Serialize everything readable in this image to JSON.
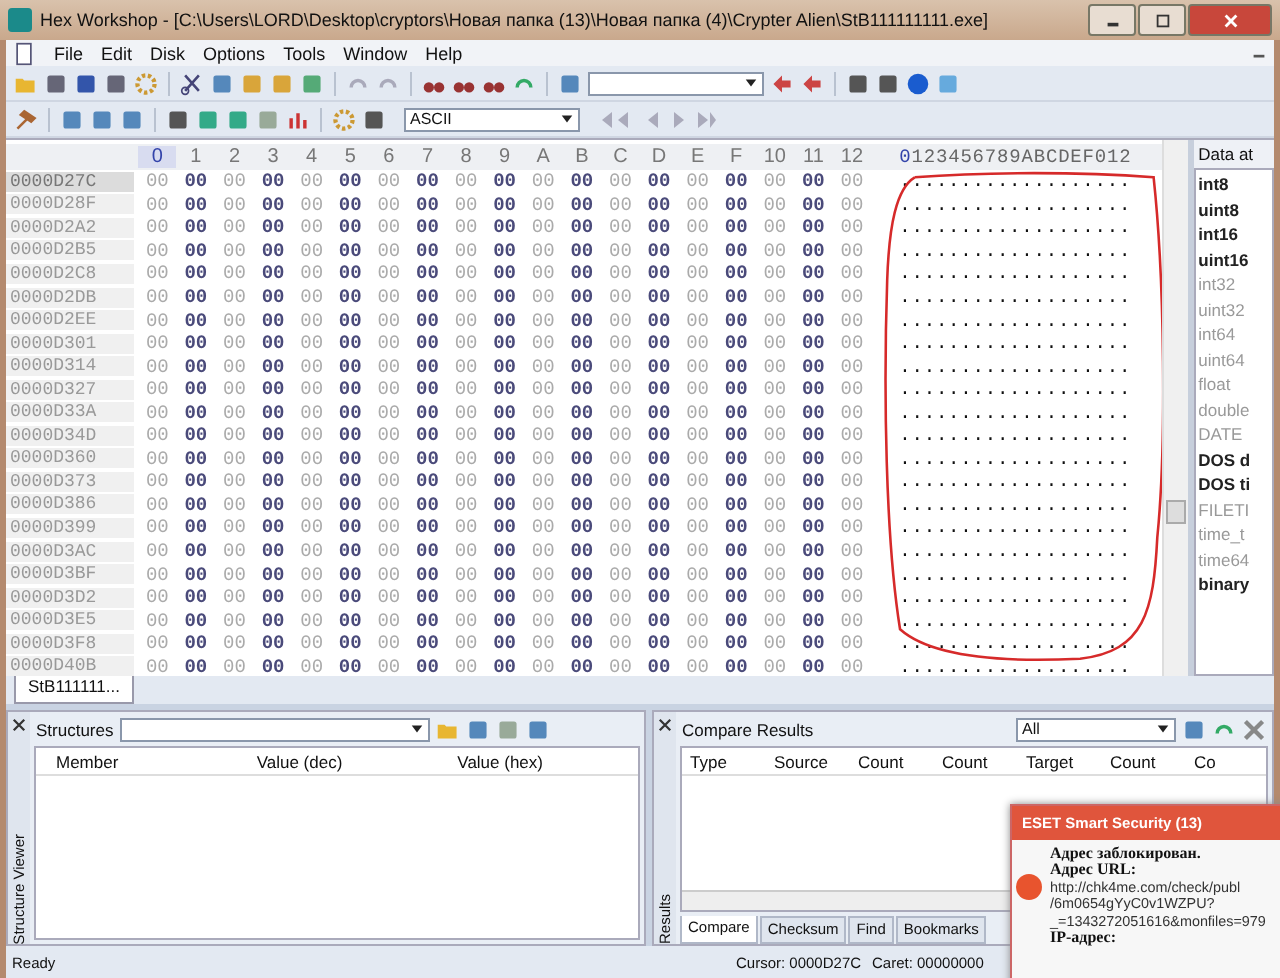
{
  "window": {
    "title": "Hex Workshop - [C:\\Users\\LORD\\Desktop\\cryptors\\Новая папка (13)\\Новая папка (4)\\Crypter Alien\\StB111111111.exe]"
  },
  "menu": [
    "File",
    "Edit",
    "Disk",
    "Options",
    "Tools",
    "Window",
    "Help"
  ],
  "toolbar": {
    "encoding": "ASCII"
  },
  "hex_view": {
    "columns": [
      {
        "label": "0",
        "selected": true
      },
      {
        "label": "1",
        "selected": false
      },
      {
        "label": "2",
        "selected": false
      },
      {
        "label": "3",
        "selected": false
      },
      {
        "label": "4",
        "selected": false
      },
      {
        "label": "5",
        "selected": false
      },
      {
        "label": "6",
        "selected": false
      },
      {
        "label": "7",
        "selected": false
      },
      {
        "label": "8",
        "selected": false
      },
      {
        "label": "9",
        "selected": false
      },
      {
        "label": "A",
        "selected": false
      },
      {
        "label": "B",
        "selected": false
      },
      {
        "label": "C",
        "selected": false
      },
      {
        "label": "D",
        "selected": false
      },
      {
        "label": "E",
        "selected": false
      },
      {
        "label": "F",
        "selected": false
      },
      {
        "label": "10",
        "selected": false
      },
      {
        "label": "11",
        "selected": false
      },
      {
        "label": "12",
        "selected": false
      }
    ],
    "ascii_header": "0123456789ABCDEF012",
    "rows": [
      {
        "offset": "0000D27C",
        "selected": true,
        "bytes": [
          "00",
          "00",
          "00",
          "00",
          "00",
          "00",
          "00",
          "00",
          "00",
          "00",
          "00",
          "00",
          "00",
          "00",
          "00",
          "00",
          "00",
          "00",
          "00"
        ],
        "ascii": "..................."
      },
      {
        "offset": "0000D28F",
        "selected": false,
        "bytes": [
          "00",
          "00",
          "00",
          "00",
          "00",
          "00",
          "00",
          "00",
          "00",
          "00",
          "00",
          "00",
          "00",
          "00",
          "00",
          "00",
          "00",
          "00",
          "00"
        ],
        "ascii": "..................."
      },
      {
        "offset": "0000D2A2",
        "selected": false,
        "bytes": [
          "00",
          "00",
          "00",
          "00",
          "00",
          "00",
          "00",
          "00",
          "00",
          "00",
          "00",
          "00",
          "00",
          "00",
          "00",
          "00",
          "00",
          "00",
          "00"
        ],
        "ascii": "..................."
      },
      {
        "offset": "0000D2B5",
        "selected": false,
        "bytes": [
          "00",
          "00",
          "00",
          "00",
          "00",
          "00",
          "00",
          "00",
          "00",
          "00",
          "00",
          "00",
          "00",
          "00",
          "00",
          "00",
          "00",
          "00",
          "00"
        ],
        "ascii": "..................."
      },
      {
        "offset": "0000D2C8",
        "selected": false,
        "bytes": [
          "00",
          "00",
          "00",
          "00",
          "00",
          "00",
          "00",
          "00",
          "00",
          "00",
          "00",
          "00",
          "00",
          "00",
          "00",
          "00",
          "00",
          "00",
          "00"
        ],
        "ascii": "..................."
      },
      {
        "offset": "0000D2DB",
        "selected": false,
        "bytes": [
          "00",
          "00",
          "00",
          "00",
          "00",
          "00",
          "00",
          "00",
          "00",
          "00",
          "00",
          "00",
          "00",
          "00",
          "00",
          "00",
          "00",
          "00",
          "00"
        ],
        "ascii": "..................."
      },
      {
        "offset": "0000D2EE",
        "selected": false,
        "bytes": [
          "00",
          "00",
          "00",
          "00",
          "00",
          "00",
          "00",
          "00",
          "00",
          "00",
          "00",
          "00",
          "00",
          "00",
          "00",
          "00",
          "00",
          "00",
          "00"
        ],
        "ascii": "..................."
      },
      {
        "offset": "0000D301",
        "selected": false,
        "bytes": [
          "00",
          "00",
          "00",
          "00",
          "00",
          "00",
          "00",
          "00",
          "00",
          "00",
          "00",
          "00",
          "00",
          "00",
          "00",
          "00",
          "00",
          "00",
          "00"
        ],
        "ascii": "..................."
      },
      {
        "offset": "0000D314",
        "selected": false,
        "bytes": [
          "00",
          "00",
          "00",
          "00",
          "00",
          "00",
          "00",
          "00",
          "00",
          "00",
          "00",
          "00",
          "00",
          "00",
          "00",
          "00",
          "00",
          "00",
          "00"
        ],
        "ascii": "..................."
      },
      {
        "offset": "0000D327",
        "selected": false,
        "bytes": [
          "00",
          "00",
          "00",
          "00",
          "00",
          "00",
          "00",
          "00",
          "00",
          "00",
          "00",
          "00",
          "00",
          "00",
          "00",
          "00",
          "00",
          "00",
          "00"
        ],
        "ascii": "..................."
      },
      {
        "offset": "0000D33A",
        "selected": false,
        "bytes": [
          "00",
          "00",
          "00",
          "00",
          "00",
          "00",
          "00",
          "00",
          "00",
          "00",
          "00",
          "00",
          "00",
          "00",
          "00",
          "00",
          "00",
          "00",
          "00"
        ],
        "ascii": "..................."
      },
      {
        "offset": "0000D34D",
        "selected": false,
        "bytes": [
          "00",
          "00",
          "00",
          "00",
          "00",
          "00",
          "00",
          "00",
          "00",
          "00",
          "00",
          "00",
          "00",
          "00",
          "00",
          "00",
          "00",
          "00",
          "00"
        ],
        "ascii": "..................."
      },
      {
        "offset": "0000D360",
        "selected": false,
        "bytes": [
          "00",
          "00",
          "00",
          "00",
          "00",
          "00",
          "00",
          "00",
          "00",
          "00",
          "00",
          "00",
          "00",
          "00",
          "00",
          "00",
          "00",
          "00",
          "00"
        ],
        "ascii": "..................."
      },
      {
        "offset": "0000D373",
        "selected": false,
        "bytes": [
          "00",
          "00",
          "00",
          "00",
          "00",
          "00",
          "00",
          "00",
          "00",
          "00",
          "00",
          "00",
          "00",
          "00",
          "00",
          "00",
          "00",
          "00",
          "00"
        ],
        "ascii": "..................."
      },
      {
        "offset": "0000D386",
        "selected": false,
        "bytes": [
          "00",
          "00",
          "00",
          "00",
          "00",
          "00",
          "00",
          "00",
          "00",
          "00",
          "00",
          "00",
          "00",
          "00",
          "00",
          "00",
          "00",
          "00",
          "00"
        ],
        "ascii": "..................."
      },
      {
        "offset": "0000D399",
        "selected": false,
        "bytes": [
          "00",
          "00",
          "00",
          "00",
          "00",
          "00",
          "00",
          "00",
          "00",
          "00",
          "00",
          "00",
          "00",
          "00",
          "00",
          "00",
          "00",
          "00",
          "00"
        ],
        "ascii": "..................."
      },
      {
        "offset": "0000D3AC",
        "selected": false,
        "bytes": [
          "00",
          "00",
          "00",
          "00",
          "00",
          "00",
          "00",
          "00",
          "00",
          "00",
          "00",
          "00",
          "00",
          "00",
          "00",
          "00",
          "00",
          "00",
          "00"
        ],
        "ascii": "..................."
      },
      {
        "offset": "0000D3BF",
        "selected": false,
        "bytes": [
          "00",
          "00",
          "00",
          "00",
          "00",
          "00",
          "00",
          "00",
          "00",
          "00",
          "00",
          "00",
          "00",
          "00",
          "00",
          "00",
          "00",
          "00",
          "00"
        ],
        "ascii": "..................."
      },
      {
        "offset": "0000D3D2",
        "selected": false,
        "bytes": [
          "00",
          "00",
          "00",
          "00",
          "00",
          "00",
          "00",
          "00",
          "00",
          "00",
          "00",
          "00",
          "00",
          "00",
          "00",
          "00",
          "00",
          "00",
          "00"
        ],
        "ascii": "..................."
      },
      {
        "offset": "0000D3E5",
        "selected": false,
        "bytes": [
          "00",
          "00",
          "00",
          "00",
          "00",
          "00",
          "00",
          "00",
          "00",
          "00",
          "00",
          "00",
          "00",
          "00",
          "00",
          "00",
          "00",
          "00",
          "00"
        ],
        "ascii": "..................."
      },
      {
        "offset": "0000D3F8",
        "selected": false,
        "bytes": [
          "00",
          "00",
          "00",
          "00",
          "00",
          "00",
          "00",
          "00",
          "00",
          "00",
          "00",
          "00",
          "00",
          "00",
          "00",
          "00",
          "00",
          "00",
          "00"
        ],
        "ascii": "..................."
      },
      {
        "offset": "0000D40B",
        "selected": false,
        "bytes": [
          "00",
          "00",
          "00",
          "00",
          "00",
          "00",
          "00",
          "00",
          "00",
          "00",
          "00",
          "00",
          "00",
          "00",
          "00",
          "00",
          "00",
          "00",
          "00"
        ],
        "ascii": "..................."
      }
    ]
  },
  "data_panel": {
    "title": "Data at",
    "items": [
      {
        "label": "int8",
        "enabled": true
      },
      {
        "label": "uint8",
        "enabled": true
      },
      {
        "label": "int16",
        "enabled": true
      },
      {
        "label": "uint16",
        "enabled": true
      },
      {
        "label": "int32",
        "enabled": false
      },
      {
        "label": "uint32",
        "enabled": false
      },
      {
        "label": "int64",
        "enabled": false
      },
      {
        "label": "uint64",
        "enabled": false
      },
      {
        "label": "float",
        "enabled": false
      },
      {
        "label": "double",
        "enabled": false
      },
      {
        "label": "DATE",
        "enabled": false
      },
      {
        "label": "DOS d",
        "enabled": true
      },
      {
        "label": "DOS ti",
        "enabled": true
      },
      {
        "label": "FILETI",
        "enabled": false
      },
      {
        "label": "time_t",
        "enabled": false
      },
      {
        "label": "time64",
        "enabled": false
      },
      {
        "label": "binary",
        "enabled": true
      }
    ]
  },
  "document_tab": "StB111111...",
  "structure_viewer": {
    "side_label": "Structure Viewer",
    "label": "Structures",
    "columns": [
      "Member",
      "Value (dec)",
      "Value (hex)"
    ]
  },
  "compare_results": {
    "side_label": "Results",
    "title": "Compare Results",
    "filter": "All",
    "columns": [
      "Type",
      "Source",
      "Count",
      "Count",
      "Target",
      "Count",
      "Co"
    ],
    "tabs": [
      {
        "label": "Compare",
        "selected": true
      },
      {
        "label": "Checksum",
        "selected": false
      },
      {
        "label": "Find",
        "selected": false
      },
      {
        "label": "Bookmarks",
        "selected": false
      }
    ]
  },
  "status_bar": {
    "message": "Ready",
    "cursor": "Cursor: 0000D27C",
    "caret": "Caret: 00000000"
  },
  "notification": {
    "title": "ESET Smart Security (13)",
    "heading": "Адрес заблокирован.",
    "url_label": "Адрес URL:",
    "url_lines": [
      "http://chk4me.com/check/publ",
      "/6m0654gYyC0v1WZPU?",
      "_=1343272051616&monfiles=979"
    ],
    "ip_label": "IP-адрес:"
  }
}
